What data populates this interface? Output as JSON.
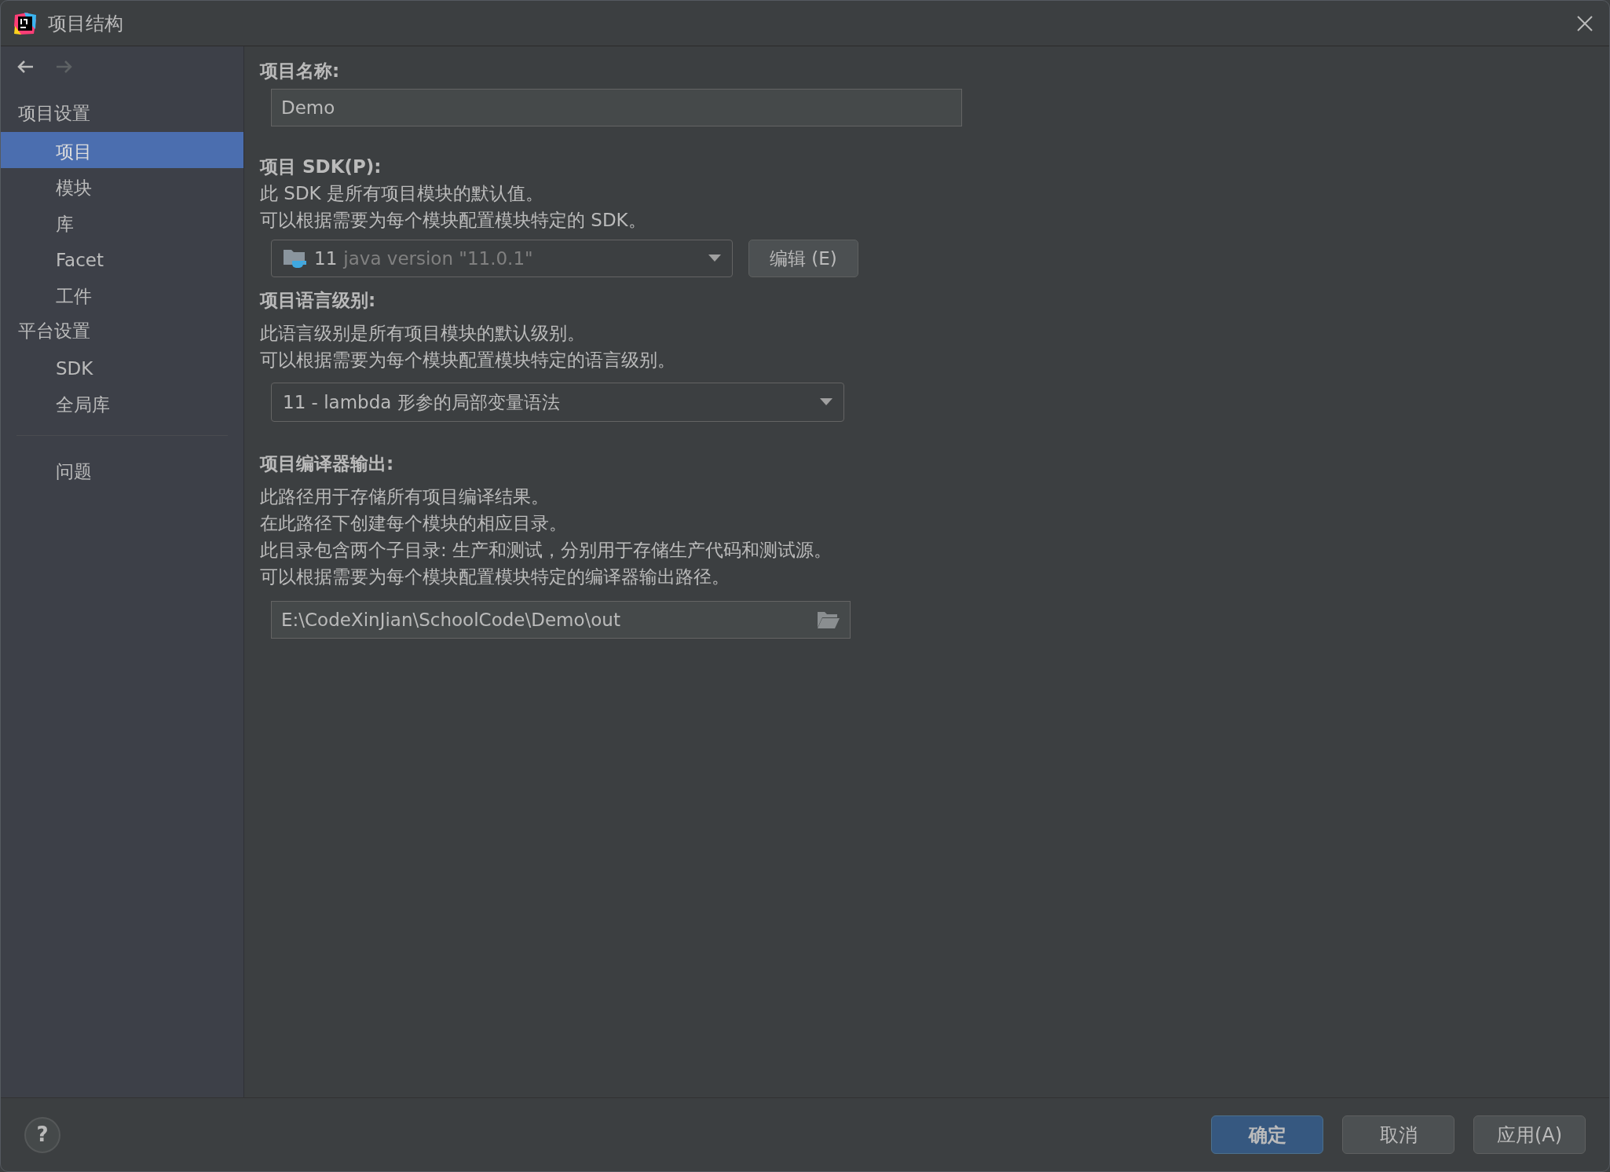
{
  "window": {
    "title": "项目结构"
  },
  "nav_buttons": [
    {
      "kind": "back",
      "disabled": false
    },
    {
      "kind": "forward",
      "disabled": true
    }
  ],
  "sidebar": {
    "groups": [
      {
        "heading": "项目设置",
        "items": [
          {
            "label": "项目",
            "selected": true
          },
          {
            "label": "模块",
            "selected": false
          },
          {
            "label": "库",
            "selected": false
          },
          {
            "label": "Facet",
            "selected": false
          },
          {
            "label": "工件",
            "selected": false
          }
        ]
      },
      {
        "heading": "平台设置",
        "items": [
          {
            "label": "SDK",
            "selected": false
          },
          {
            "label": "全局库",
            "selected": false
          }
        ]
      },
      {
        "items": [
          {
            "label": "问题",
            "selected": false
          }
        ]
      }
    ]
  },
  "project_name": {
    "label": "项目名称:",
    "value": "Demo"
  },
  "project_sdk": {
    "label": "项目 SDK(P):",
    "description": [
      "此 SDK 是所有项目模块的默认值。",
      "可以根据需要为每个模块配置模块特定的 SDK。"
    ],
    "sdk_name": "11",
    "sdk_version": "java version \"11.0.1\"",
    "edit_button": "编辑 (E)"
  },
  "language_level": {
    "label": "项目语言级别:",
    "description": [
      "此语言级别是所有项目模块的默认级别。",
      "可以根据需要为每个模块配置模块特定的语言级别。"
    ],
    "value": "11 - lambda 形参的局部变量语法"
  },
  "compiler_output": {
    "label": "项目编译器输出:",
    "description": [
      "此路径用于存储所有项目编译结果。",
      "在此路径下创建每个模块的相应目录。",
      "此目录包含两个子目录: 生产和测试，分别用于存储生产代码和测试源。",
      "可以根据需要为每个模块配置模块特定的编译器输出路径。"
    ],
    "value": "E:\\CodeXinJian\\SchoolCode\\Demo\\out"
  },
  "footer": {
    "help": "?",
    "buttons": [
      {
        "label": "确定",
        "kind": "default"
      },
      {
        "label": "取消",
        "kind": "normal"
      },
      {
        "label": "应用(A)",
        "kind": "normal"
      }
    ]
  }
}
